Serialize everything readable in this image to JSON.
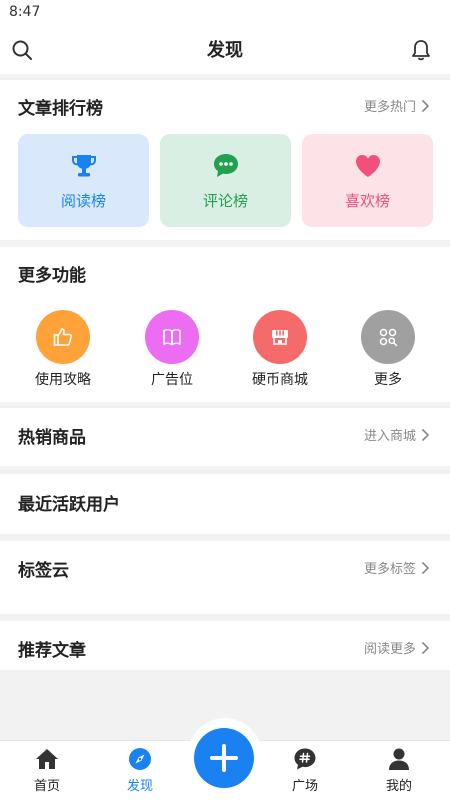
{
  "status_bar": {
    "time": "8:47"
  },
  "header": {
    "title": "发现"
  },
  "ranking": {
    "title": "文章排行榜",
    "more_label": "更多热门",
    "items": [
      {
        "label": "阅读榜",
        "icon": "trophy-icon",
        "color": "#1a82f0",
        "bg": "#d9e9fb"
      },
      {
        "label": "评论榜",
        "icon": "comment-icon",
        "color": "#22a050",
        "bg": "#d9efe3"
      },
      {
        "label": "喜欢榜",
        "icon": "heart-icon",
        "color": "#f0507a",
        "bg": "#fde2e8"
      }
    ]
  },
  "functions": {
    "title": "更多功能",
    "items": [
      {
        "label": "使用攻略",
        "icon": "thumbs-up-icon",
        "color": "#ffa23a"
      },
      {
        "label": "广告位",
        "icon": "book-icon",
        "color": "#ec6cf2"
      },
      {
        "label": "硬币商城",
        "icon": "shop-icon",
        "color": "#f56b6b"
      },
      {
        "label": "更多",
        "icon": "more-apps-icon",
        "color": "#a0a0a0"
      }
    ]
  },
  "hot_products": {
    "title": "热销商品",
    "more_label": "进入商城"
  },
  "active_users": {
    "title": "最近活跃用户"
  },
  "tag_cloud": {
    "title": "标签云",
    "more_label": "更多标签"
  },
  "recommended": {
    "title": "推荐文章",
    "more_label": "阅读更多"
  },
  "tab_bar": {
    "accent": "#1a82f0",
    "items": [
      {
        "label": "首页",
        "icon": "home-icon",
        "active": false
      },
      {
        "label": "发现",
        "icon": "compass-icon",
        "active": true
      },
      {
        "label": "广场",
        "icon": "hashtag-icon",
        "active": false
      },
      {
        "label": "我的",
        "icon": "user-icon",
        "active": false
      }
    ],
    "fab_icon": "plus-icon"
  }
}
